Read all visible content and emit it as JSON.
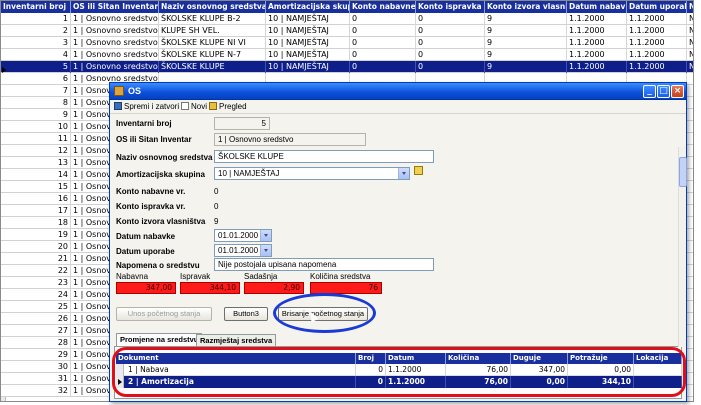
{
  "background_grid": {
    "columns": [
      "Inventarni broj",
      "OS ili Sitan Inventar",
      "Naziv osnovnog sredstva",
      "Amortizacijska skupina",
      "Konto nabavne vr.",
      "Konto ispravka vr.",
      "Konto izvora vlasništva",
      "Datum nabavke",
      "Datum uporabe",
      "N"
    ],
    "rows": [
      [
        "1",
        "1 | Osnovno sredstvo",
        "ŠKOLSKE KLUPE B-2",
        "10 | NAMJEŠTAJ",
        "0",
        "0",
        "9",
        "1.1.2000",
        "1.1.2000",
        "N"
      ],
      [
        "2",
        "1 | Osnovno sredstvo",
        "KLUPE SH VEL.",
        "10 | NAMJEŠTAJ",
        "0",
        "0",
        "9",
        "1.1.2000",
        "1.1.2000",
        "N"
      ],
      [
        "3",
        "1 | Osnovno sredstvo",
        "ŠKOLSKE KLUPE NI VI",
        "10 | NAMJEŠTAJ",
        "0",
        "0",
        "9",
        "1.1.2000",
        "1.1.2000",
        "N"
      ],
      [
        "4",
        "1 | Osnovno sredstvo",
        "ŠKOLSKE KLUPE N-7",
        "10 | NAMJEŠTAJ",
        "0",
        "0",
        "9",
        "1.1.2000",
        "1.1.2000",
        "N"
      ],
      [
        "5",
        "1 | Osnovno sredstvo",
        "ŠKOLSKE KLUPE",
        "10 | NAMJEŠTAJ",
        "0",
        "0",
        "9",
        "1.1.2000",
        "1.1.2000",
        "N"
      ],
      [
        "6",
        "1 | Osnovno sredstvo",
        "",
        "",
        "",
        "",
        "",
        "",
        "",
        ""
      ],
      [
        "7",
        "1 | Osnovno sredstvo",
        "",
        "",
        "",
        "",
        "",
        "",
        "",
        ""
      ],
      [
        "8",
        "1 | Osnovno sredstvo",
        "",
        "",
        "",
        "",
        "",
        "",
        "",
        ""
      ],
      [
        "9",
        "1 | Osnovno sredstvo",
        "",
        "",
        "",
        "",
        "",
        "",
        "",
        ""
      ],
      [
        "10",
        "1 | Osnovno sredstvo",
        "",
        "",
        "",
        "",
        "",
        "",
        "",
        ""
      ],
      [
        "11",
        "1 | Osnovno sredstvo",
        "",
        "",
        "",
        "",
        "",
        "",
        "",
        ""
      ],
      [
        "12",
        "1 | Osnovno sredstvo",
        "",
        "",
        "",
        "",
        "",
        "",
        "",
        ""
      ],
      [
        "13",
        "1 | Osnovno sredstvo",
        "",
        "",
        "",
        "",
        "",
        "",
        "",
        ""
      ],
      [
        "14",
        "1 | Osnovno sredstvo",
        "",
        "",
        "",
        "",
        "",
        "",
        "",
        ""
      ],
      [
        "15",
        "1 | Osnovno sredstvo",
        "",
        "",
        "",
        "",
        "",
        "",
        "",
        ""
      ],
      [
        "16",
        "1 | Osnovno sredstvo",
        "",
        "",
        "",
        "",
        "",
        "",
        "",
        ""
      ],
      [
        "17",
        "1 | Osnovno sredstvo",
        "",
        "",
        "",
        "",
        "",
        "",
        "",
        ""
      ],
      [
        "18",
        "1 | Osnovno sredstvo",
        "",
        "",
        "",
        "",
        "",
        "",
        "",
        ""
      ],
      [
        "19",
        "1 | Osnovno sredstvo",
        "",
        "",
        "",
        "",
        "",
        "",
        "",
        ""
      ],
      [
        "20",
        "1 | Osnovno sredstvo",
        "",
        "",
        "",
        "",
        "",
        "",
        "",
        ""
      ],
      [
        "21",
        "1 | Osnovno sredstvo",
        "",
        "",
        "",
        "",
        "",
        "",
        "",
        ""
      ],
      [
        "22",
        "1 | Osnovno sredstvo",
        "",
        "",
        "",
        "",
        "",
        "",
        "",
        ""
      ],
      [
        "23",
        "1 | Osnovno sredstvo",
        "",
        "",
        "",
        "",
        "",
        "",
        "",
        ""
      ],
      [
        "24",
        "1 | Osnovno sredstvo",
        "",
        "",
        "",
        "",
        "",
        "",
        "",
        ""
      ],
      [
        "25",
        "1 | Osnovno sredstvo",
        "",
        "",
        "",
        "",
        "",
        "",
        "",
        ""
      ],
      [
        "26",
        "1 | Osnovno sredstvo",
        "",
        "",
        "",
        "",
        "",
        "",
        "",
        ""
      ],
      [
        "27",
        "1 | Osnovno sredstvo",
        "",
        "",
        "",
        "",
        "",
        "",
        "",
        ""
      ],
      [
        "28",
        "1 | Osnovno sredstvo",
        "",
        "",
        "",
        "",
        "",
        "",
        "",
        ""
      ],
      [
        "29",
        "1 | Osnovno sredstvo",
        "",
        "",
        "",
        "",
        "",
        "",
        "",
        ""
      ],
      [
        "30",
        "1 | Osnovno sredstvo",
        "",
        "",
        "",
        "",
        "",
        "",
        "",
        ""
      ],
      [
        "31",
        "1 | Osnovno sredstvo",
        "",
        "",
        "",
        "",
        "",
        "",
        "",
        ""
      ],
      [
        "32",
        "1 | Osnovno sredstvo",
        "",
        "",
        "",
        "",
        "",
        "",
        "",
        ""
      ]
    ],
    "selected_row": 4
  },
  "dialog": {
    "title": "OS",
    "toolbar": {
      "save_close": "Spremi i zatvori",
      "new": "Novi",
      "preview": "Pregled"
    },
    "fields": {
      "inv_broj_label": "Inventarni broj",
      "inv_broj_value": "5",
      "os_label": "OS ili Sitan Inventar",
      "os_value": "1 | Osnovno sredstvo",
      "naziv_label": "Naziv osnovnog sredstva",
      "naziv_value": "ŠKOLSKE KLUPE",
      "amort_label": "Amortizacijska skupina",
      "amort_value": "10 | NAMJEŠTAJ",
      "konto_nabavne_label": "Konto nabavne vr.",
      "konto_nabavne_value": "0",
      "konto_ispravka_label": "Konto ispravka vr.",
      "konto_ispravka_value": "0",
      "konto_izvora_label": "Konto izvora vlasništva",
      "konto_izvora_value": "9",
      "datum_nabavke_label": "Datum nabavke",
      "datum_nabavke_value": "01.01.2000",
      "datum_uporabe_label": "Datum uporabe",
      "datum_uporabe_value": "01.01.2000",
      "napomena_label": "Napomena o sredstvu",
      "napomena_value": "Nije postojala upisana napomena"
    },
    "money": {
      "nabavna_label": "Nabavna",
      "nabavna_value": "347,00",
      "ispravak_label": "Ispravak",
      "ispravak_value": "344,10",
      "sadasnja_label": "Sadašnja",
      "sadasnja_value": "2,90",
      "kolicina_label": "Količina sredstva",
      "kolicina_value": "76"
    },
    "buttons": {
      "unos": "Unos početnog stanja",
      "button3": "Button3",
      "brisanje": "Brisanje početnog stanja"
    },
    "tabs": [
      "Promjene na sredstvu",
      "Razmještaj sredstva"
    ],
    "detail_grid": {
      "columns": [
        "Dokument",
        "Broj",
        "Datum",
        "Količina",
        "Duguje",
        "Potražuje",
        "Lokacija"
      ],
      "rows": [
        [
          "1 | Nabava",
          "0",
          "1.1.2000",
          "76,00",
          "347,00",
          "0,00",
          ""
        ],
        [
          "2 | Amortizacija",
          "0",
          "1.1.2000",
          "76,00",
          "0,00",
          "344,10",
          ""
        ]
      ]
    }
  },
  "colors": {
    "grid_header": "#1a2f9e",
    "selection": "#0f1f8a",
    "money_box": "#ff1a1a",
    "blue_highlight": "#1a3ad8",
    "red_highlight": "#e0101a"
  }
}
